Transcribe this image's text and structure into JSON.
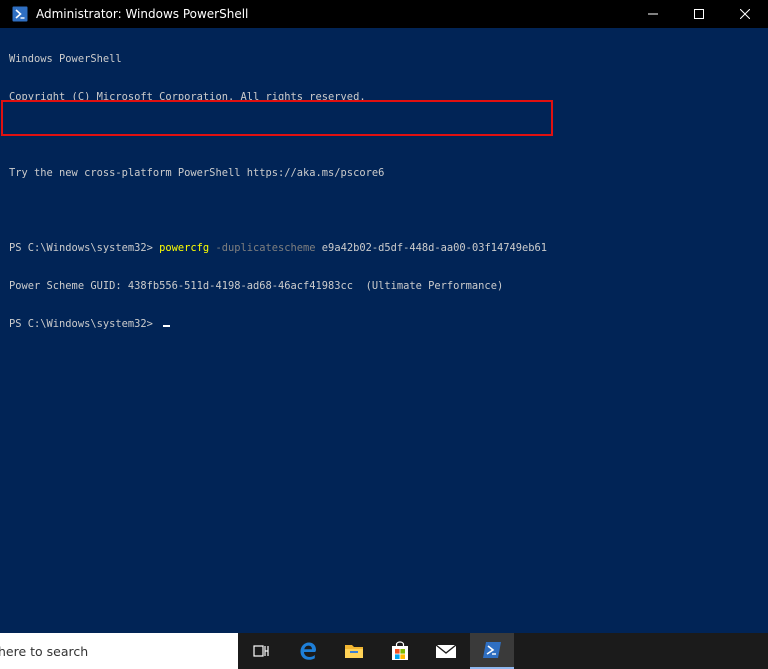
{
  "window": {
    "title": "Administrator: Windows PowerShell"
  },
  "console": {
    "lines": {
      "banner1": "Windows PowerShell",
      "banner2": "Copyright (C) Microsoft Corporation. All rights reserved.",
      "blank1": "",
      "banner3": "Try the new cross-platform PowerShell https://aka.ms/pscore6",
      "blank2": "",
      "cmd_prompt": "PS C:\\Windows\\system32> ",
      "cmd_name": "powercfg",
      "cmd_param": " -duplicatescheme",
      "cmd_arg": " e9a42b02-d5df-448d-aa00-03f14749eb61",
      "result": "Power Scheme GUID: 438fb556-511d-4198-ad68-46acf41983cc  (Ultimate Performance)",
      "prompt2": "PS C:\\Windows\\system32> "
    }
  },
  "taskbar": {
    "search_placeholder": "here to search",
    "apps": [
      {
        "name": "task-view-icon"
      },
      {
        "name": "edge-icon"
      },
      {
        "name": "file-explorer-icon"
      },
      {
        "name": "store-icon"
      },
      {
        "name": "mail-icon"
      },
      {
        "name": "powershell-icon",
        "active": true
      }
    ]
  },
  "colors": {
    "console_bg": "#012456",
    "highlight": "#e01010",
    "command": "#ffff00"
  }
}
